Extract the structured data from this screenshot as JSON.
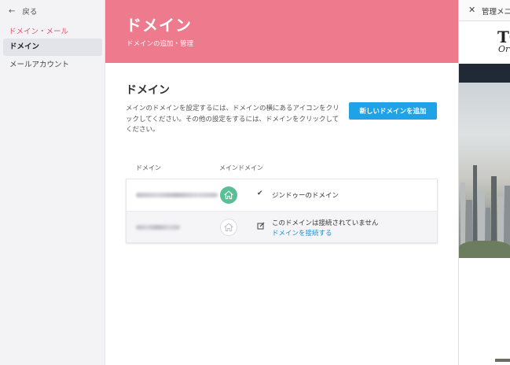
{
  "sidebar": {
    "back_label": "戻る",
    "section_label": "ドメイン・メール",
    "items": [
      {
        "label": "ドメイン",
        "active": true
      },
      {
        "label": "メールアカウント",
        "active": false
      }
    ]
  },
  "banner": {
    "title": "ドメイン",
    "subtitle": "ドメインの追加・管理"
  },
  "content": {
    "title": "ドメイン",
    "description": "メインのドメインを設定するには、ドメインの横にあるアイコンをクリックしてください。その他の設定をするには、ドメインをクリックしてください。",
    "add_button_label": "新しいドメインを追加"
  },
  "table": {
    "headers": {
      "domain": "ドメイン",
      "main_domain": "メインドメイン"
    },
    "rows": [
      {
        "status_icon": "check-icon",
        "status_text": "ジンドゥーのドメイン",
        "is_main": true
      },
      {
        "status_icon": "edit-icon",
        "status_text": "このドメインは接続されていません",
        "link_text": "ドメインを接続する",
        "is_main": false
      }
    ]
  },
  "preview": {
    "header_title": "管理メニュー",
    "logo_text": "TO",
    "logo_script": "Or"
  },
  "colors": {
    "accent_pink": "#ee7a8e",
    "section_red": "#e8526e",
    "button_blue": "#1fa3e6",
    "main_green": "#5bbf96",
    "link_blue": "#1a8fd6"
  }
}
